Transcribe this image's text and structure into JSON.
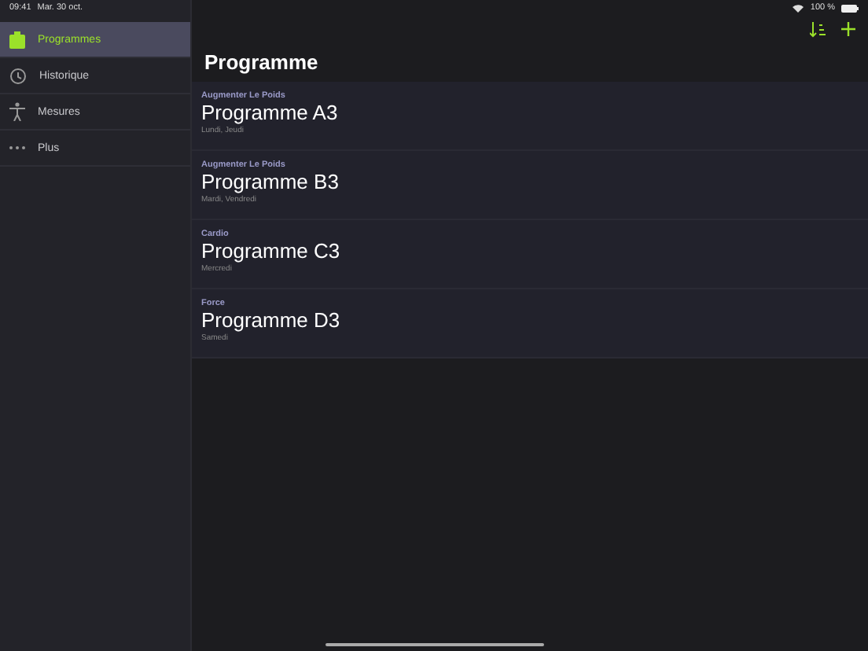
{
  "status_bar": {
    "time": "09:41",
    "date": "Mar. 30 oct.",
    "battery": "100 %"
  },
  "sidebar": {
    "items": [
      {
        "label": "Programmes",
        "kind": "clipboard",
        "selected": true
      },
      {
        "label": "Historique",
        "kind": "history",
        "selected": false
      },
      {
        "label": "Mesures",
        "kind": "body",
        "selected": false
      },
      {
        "label": "Plus",
        "kind": "more",
        "selected": false
      }
    ]
  },
  "header": {
    "title": "Programme"
  },
  "programs": [
    {
      "category": "Augmenter Le Poids",
      "name": "Programme A3",
      "days": "Lundi, Jeudi"
    },
    {
      "category": "Augmenter Le Poids",
      "name": "Programme B3",
      "days": "Mardi, Vendredi"
    },
    {
      "category": "Cardio",
      "name": "Programme C3",
      "days": "Mercredi"
    },
    {
      "category": "Force",
      "name": "Programme D3",
      "days": "Samedi"
    }
  ]
}
